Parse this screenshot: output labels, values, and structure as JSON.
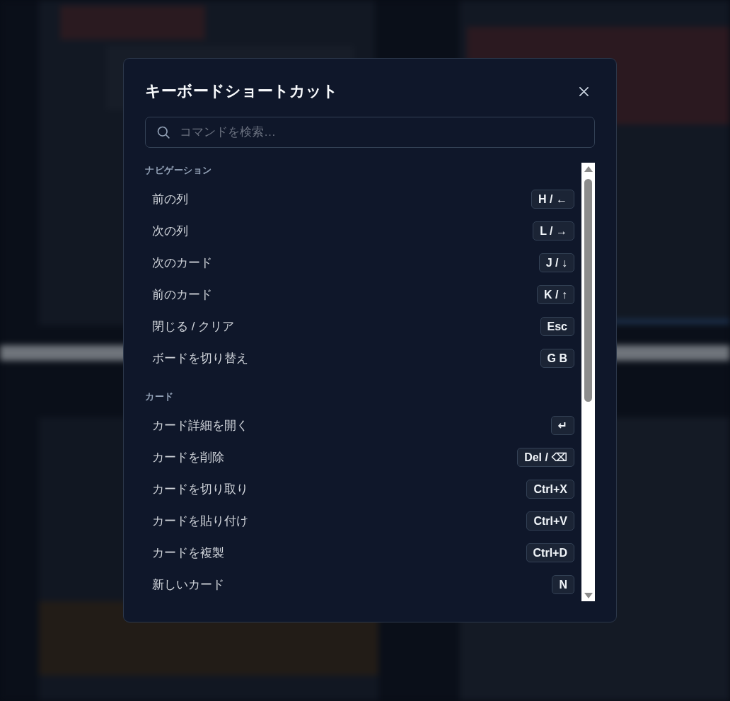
{
  "dialog": {
    "title": "キーボードショートカット",
    "search": {
      "placeholder": "コマンドを検索…"
    },
    "sections": [
      {
        "heading": "ナビゲーション",
        "shortcuts": [
          {
            "label": "前の列",
            "keys": "H / ←"
          },
          {
            "label": "次の列",
            "keys": "L / →"
          },
          {
            "label": "次のカード",
            "keys": "J / ↓"
          },
          {
            "label": "前のカード",
            "keys": "K / ↑"
          },
          {
            "label": "閉じる / クリア",
            "keys": "Esc"
          },
          {
            "label": "ボードを切り替え",
            "keys": "G B"
          }
        ]
      },
      {
        "heading": "カード",
        "shortcuts": [
          {
            "label": "カード詳細を開く",
            "keys": "↵"
          },
          {
            "label": "カードを削除",
            "keys": "Del / ⌫"
          },
          {
            "label": "カードを切り取り",
            "keys": "Ctrl+X"
          },
          {
            "label": "カードを貼り付け",
            "keys": "Ctrl+V"
          },
          {
            "label": "カードを複製",
            "keys": "Ctrl+D"
          },
          {
            "label": "新しいカード",
            "keys": "N"
          }
        ]
      }
    ]
  }
}
